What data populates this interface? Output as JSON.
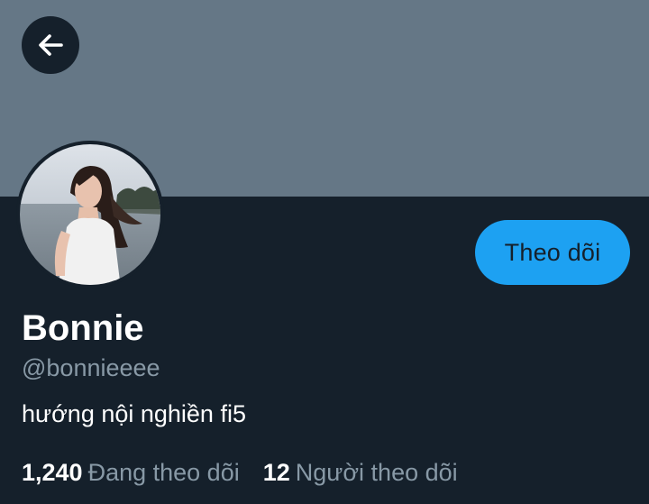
{
  "header": {
    "banner_color": "#657786",
    "back_icon": "arrow-left-icon"
  },
  "profile": {
    "avatar_description": "profile photo",
    "display_name": "Bonnie",
    "handle": "@bonnieeee",
    "bio": "hướng nội nghiền fi5",
    "follow_button_label": "Theo dõi",
    "following_count": "1,240",
    "following_label": "Đang theo dõi",
    "followers_count": "12",
    "followers_label": "Người theo dõi"
  },
  "colors": {
    "background": "#15202b",
    "accent": "#1da1f2",
    "secondary_text": "#8899a6",
    "primary_text": "#ffffff"
  }
}
